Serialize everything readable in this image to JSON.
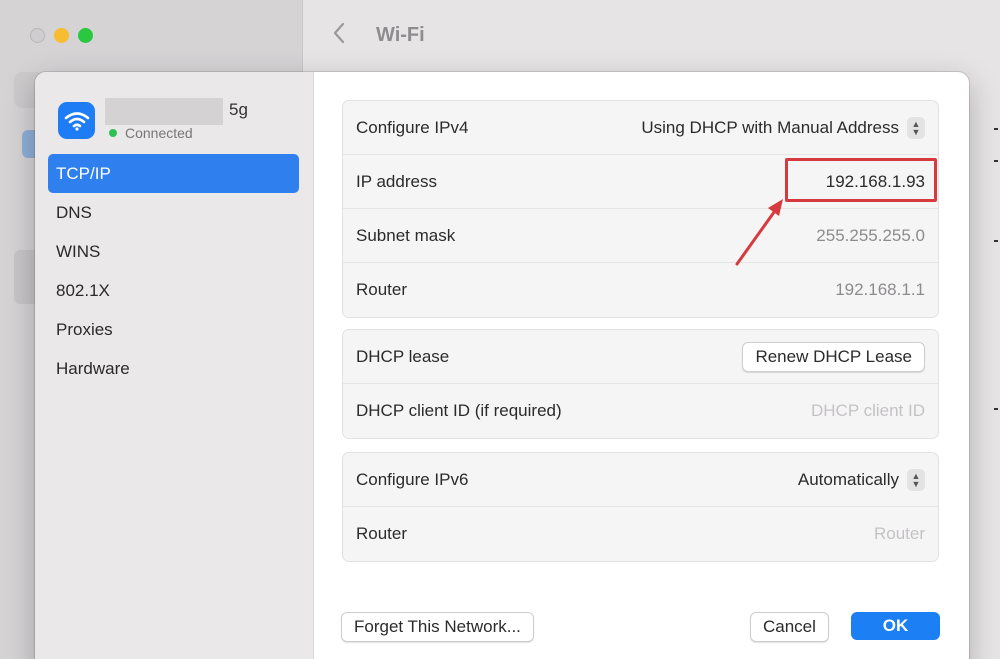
{
  "window": {
    "title": "Wi-Fi",
    "back_icon": "chevron-left-icon"
  },
  "network": {
    "name_suffix": "5g",
    "status": "Connected",
    "status_color": "#2fc154",
    "icon": "wifi-icon",
    "badge_color": "#1e7cf4"
  },
  "sidebar": {
    "items": [
      {
        "label": "TCP/IP",
        "active": true
      },
      {
        "label": "DNS"
      },
      {
        "label": "WINS"
      },
      {
        "label": "802.1X"
      },
      {
        "label": "Proxies"
      },
      {
        "label": "Hardware"
      }
    ],
    "accent": "#2f80ee"
  },
  "ipv4": {
    "configure_label": "Configure IPv4",
    "configure_value": "Using DHCP with Manual Address",
    "ip_label": "IP address",
    "ip_value": "192.168.1.93",
    "subnet_label": "Subnet mask",
    "subnet_value": "255.255.255.0",
    "router_label": "Router",
    "router_value": "192.168.1.1"
  },
  "dhcp": {
    "lease_label": "DHCP lease",
    "renew_button": "Renew DHCP Lease",
    "client_id_label": "DHCP client ID (if required)",
    "client_id_placeholder": "DHCP client ID"
  },
  "ipv6": {
    "configure_label": "Configure IPv6",
    "configure_value": "Automatically",
    "router_label": "Router",
    "router_placeholder": "Router"
  },
  "footer": {
    "forget_button": "Forget This Network...",
    "cancel_button": "Cancel",
    "ok_button": "OK",
    "ok_color": "#1c7ff4"
  },
  "annotation": {
    "highlight_color": "#d63a3f"
  }
}
